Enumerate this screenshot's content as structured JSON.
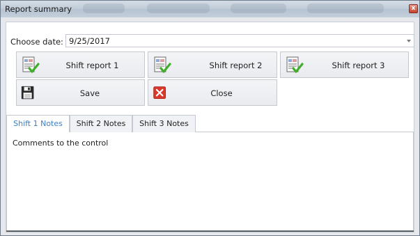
{
  "window": {
    "title": "Report summary",
    "close_glyph": "x"
  },
  "date": {
    "label": "Choose date:",
    "value": "9/25/2017"
  },
  "reports": [
    {
      "label": "Shift report 1",
      "icon": "report-check-icon"
    },
    {
      "label": "Shift report 2",
      "icon": "report-check-icon"
    },
    {
      "label": "Shift report 3",
      "icon": "report-check-icon"
    }
  ],
  "actions": {
    "save_label": "Save",
    "save_icon": "floppy-disk-icon",
    "close_label": "Close",
    "close_icon": "red-x-icon"
  },
  "tabs": [
    {
      "label": "Shift 1 Notes",
      "active": true
    },
    {
      "label": "Shift 2 Notes",
      "active": false
    },
    {
      "label": "Shift 3 Notes",
      "active": false
    }
  ],
  "notes": {
    "text": "Comments to the control"
  },
  "colors": {
    "active_tab": "#3c7fc4",
    "close_red": "#d8392b",
    "check_green": "#3fae2a"
  }
}
